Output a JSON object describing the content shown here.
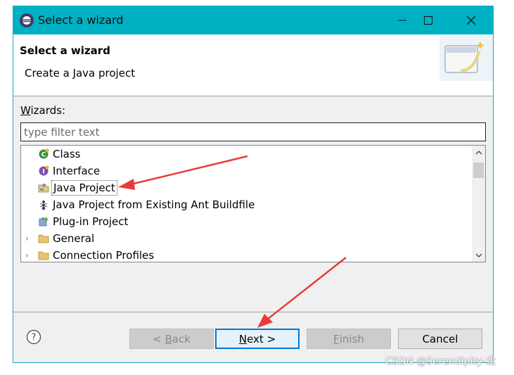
{
  "window": {
    "title": "Select a wizard",
    "controls": [
      "minimize",
      "maximize",
      "close"
    ]
  },
  "header": {
    "title": "Select a wizard",
    "subtitle": "Create a Java project"
  },
  "wizards": {
    "label_prefix": "W",
    "label_rest": "izards:",
    "filter_placeholder": "type filter text",
    "filter_value": ""
  },
  "tree": {
    "items": [
      {
        "label": "Class",
        "icon": "java-class-icon",
        "expandable": false,
        "selected": false
      },
      {
        "label": "Interface",
        "icon": "java-interface-icon",
        "expandable": false,
        "selected": false
      },
      {
        "label": "Java Project",
        "icon": "java-project-icon",
        "expandable": false,
        "selected": true
      },
      {
        "label": "Java Project from Existing Ant Buildfile",
        "icon": "ant-icon",
        "expandable": false,
        "selected": false
      },
      {
        "label": "Plug-in Project",
        "icon": "plugin-project-icon",
        "expandable": false,
        "selected": false
      },
      {
        "label": "General",
        "icon": "folder-icon",
        "expandable": true,
        "selected": false
      },
      {
        "label": "Connection Profiles",
        "icon": "folder-icon",
        "expandable": true,
        "selected": false
      }
    ]
  },
  "buttons": {
    "back": {
      "pre": "< ",
      "mnemonic": "B",
      "rest": "ack",
      "enabled": false
    },
    "next": {
      "mnemonic": "N",
      "rest": "ext >",
      "enabled": true
    },
    "finish": {
      "mnemonic": "F",
      "rest": "inish",
      "enabled": false
    },
    "cancel": {
      "label": "Cancel",
      "enabled": true
    }
  },
  "watermark": "CSDN @Serendipity-龙",
  "colors": {
    "titlebar": "#00b1c4",
    "annotation_arrow": "#e83a3a",
    "default_button_border": "#0078d7"
  }
}
